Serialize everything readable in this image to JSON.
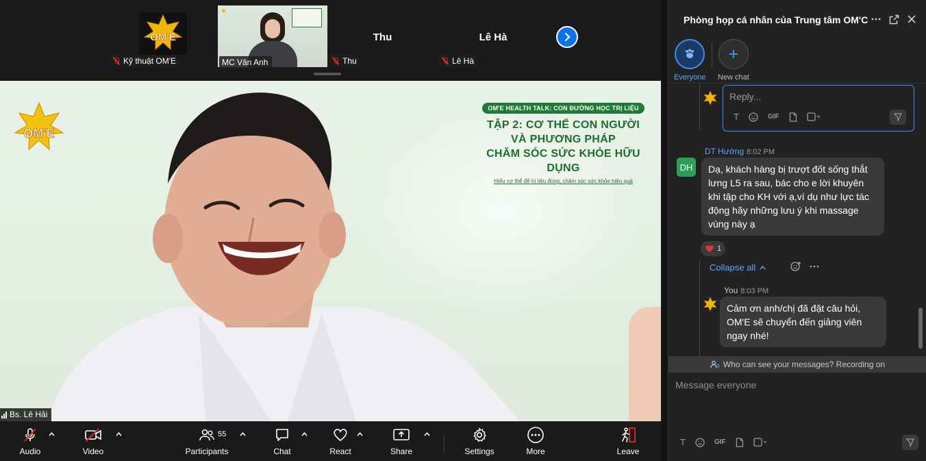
{
  "top_strip": {
    "tiles": [
      {
        "name": "Kỹ thuật OM'E"
      },
      {
        "name": "MC Vân Anh"
      },
      {
        "name": "Thu",
        "title": "Thu"
      },
      {
        "name": "Lê Hà",
        "title": "Lê Hà"
      }
    ]
  },
  "main_video": {
    "speaker_name": "Bs. Lê Hải",
    "logo_text": "OM'E",
    "poster": {
      "badge": "OM'E HEALTH TALK: CON ĐƯỜNG HỌC TRỊ LIỆU",
      "lines": [
        "TẬP 2: CƠ THỂ CON NGƯỜI",
        "VÀ PHƯƠNG PHÁP",
        "CHĂM SÓC SỨC KHỎE HỮU DỤNG"
      ],
      "subtitle": "Hiểu cơ thể để trị liệu đúng, chăm sóc sức khỏe hiệu quả"
    }
  },
  "toolbar": {
    "audio": "Audio",
    "video": "Video",
    "participants": "Participants",
    "participants_count": "55",
    "chat": "Chat",
    "react": "React",
    "share": "Share",
    "settings": "Settings",
    "more": "More",
    "leave": "Leave"
  },
  "chat_panel": {
    "title": "Phòng họp cá nhân của Trung tâm OM'C",
    "tabs": {
      "everyone": "Everyone",
      "new_chat": "New chat"
    },
    "reply_placeholder": "Reply...",
    "gif": "GIF",
    "messages": [
      {
        "avatar": "DH",
        "sender": "DT Hướng",
        "time": "8:02 PM",
        "text": "Dạ, khách hàng bị trượt đốt sống thắt lưng L5 ra sau, bác cho e lời khuyên khi tập cho KH với ạ,ví dụ như lực tác động hãy những lưu ý khi massage vùng này ạ",
        "reaction_count": "1"
      },
      {
        "sender": "You",
        "time": "8:03 PM",
        "text": "Cảm ơn anh/chị đã đặt câu hỏi, OM'E sẽ chuyển đến giảng viên ngay nhé!"
      }
    ],
    "collapse_all": "Collapse all",
    "visibility_note": "Who can see your messages? Recording on",
    "compose_placeholder": "Message everyone"
  },
  "colors": {
    "accent": "#0e72ed",
    "link": "#5ea6ff",
    "danger": "#e02828",
    "avatar_green": "#2aa05a",
    "poster_green": "#1f7a35"
  }
}
